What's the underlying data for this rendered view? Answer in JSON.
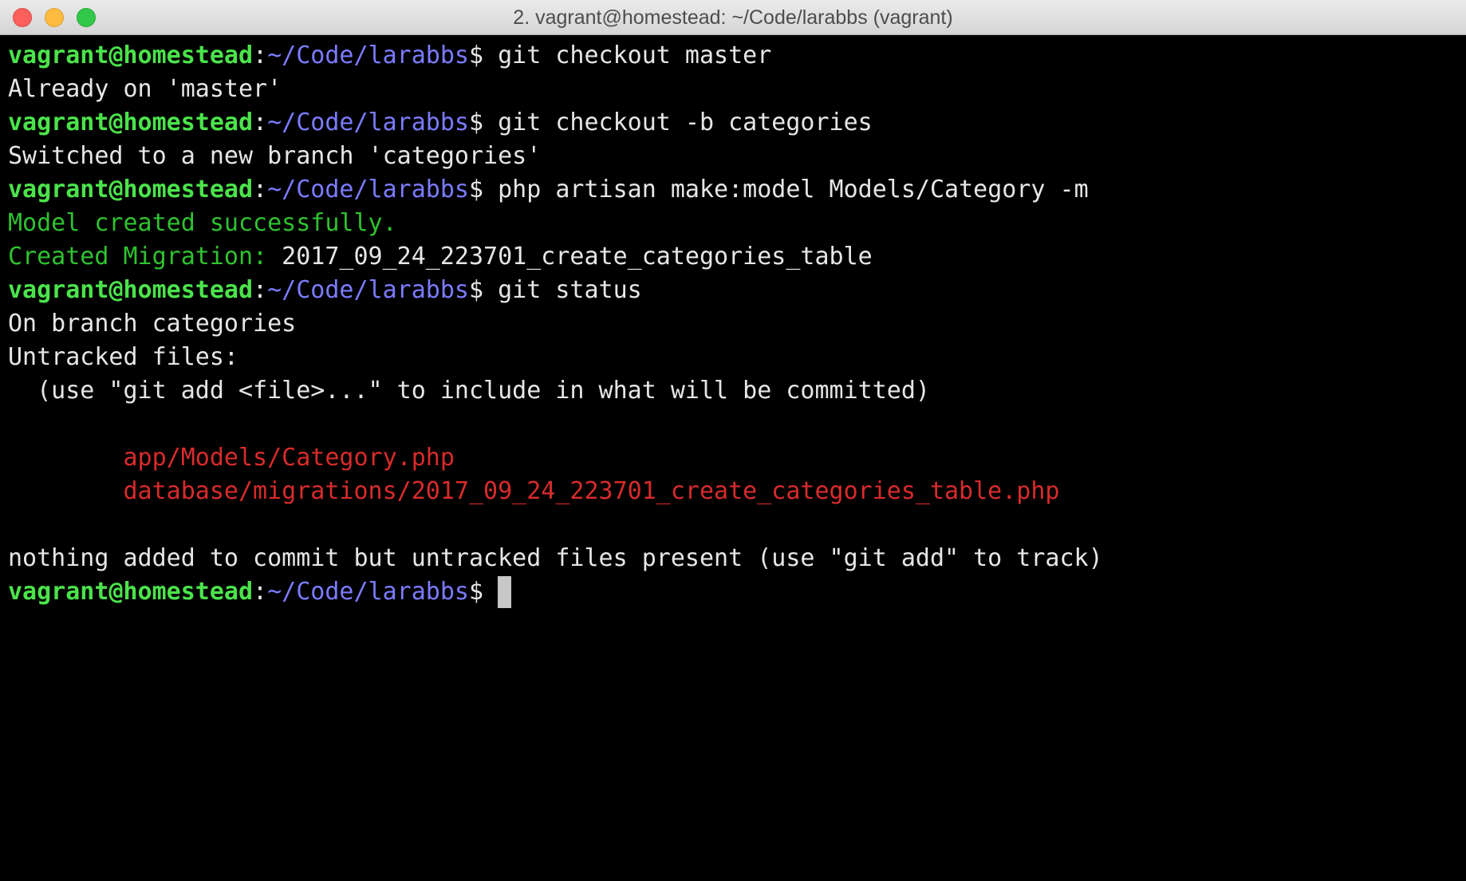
{
  "window": {
    "title": "2. vagrant@homestead: ~/Code/larabbs (vagrant)"
  },
  "prompt": {
    "user_host": "vagrant@homestead",
    "colon": ":",
    "path": "~/Code/larabbs",
    "dollar": "$ "
  },
  "lines": {
    "cmd1": "git checkout master",
    "out1": "Already on 'master'",
    "cmd2": "git checkout -b categories",
    "out2": "Switched to a new branch 'categories'",
    "cmd3": "php artisan make:model Models/Category -m",
    "out3": "Model created successfully.",
    "out4_label": "Created Migration: ",
    "out4_value": "2017_09_24_223701_create_categories_table",
    "cmd4": "git status",
    "out5": "On branch categories",
    "out6": "Untracked files:",
    "out7": "  (use \"git add <file>...\" to include in what will be committed)",
    "file1": "        app/Models/Category.php",
    "file2": "        database/migrations/2017_09_24_223701_create_categories_table.php",
    "out8": "nothing added to commit but untracked files present (use \"git add\" to track)"
  },
  "colors": {
    "prompt_user": "#4be34b",
    "prompt_path": "#7b7bff",
    "success_green": "#2fc22f",
    "untracked_red": "#d82b2b",
    "background": "#000000"
  }
}
